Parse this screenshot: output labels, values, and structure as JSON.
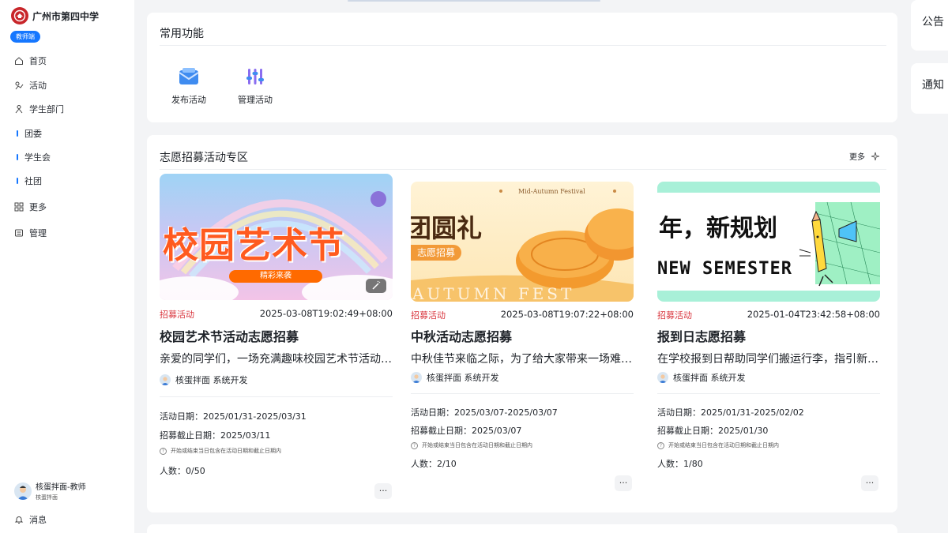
{
  "school": {
    "name": "广州市第四中学",
    "role": "教师端"
  },
  "nav": {
    "home": "首页",
    "activity": "活动",
    "department": "学生部门",
    "sub": [
      "团委",
      "学生会",
      "社团"
    ],
    "more": "更多",
    "manage": "管理"
  },
  "user": {
    "name": "核蛋拌面-教师",
    "sub": "核蛋拌面"
  },
  "messages": "消息",
  "common": {
    "title": "常用功能",
    "functions": [
      {
        "label": "发布活动",
        "icon": "envelope-icon"
      },
      {
        "label": "管理活动",
        "icon": "sliders-icon"
      }
    ]
  },
  "volunteer": {
    "title": "志愿招募活动专区",
    "more": "更多",
    "cards": [
      {
        "category": "招募活动",
        "time": "2025-03-08T19:02:49+08:00",
        "title": "校园艺术节活动志愿招募",
        "desc": "亲爱的同学们，一场充满趣味校园艺术节活动即将开始，诚邀你加入志愿者团队",
        "author": "核蛋拌面 系统开发",
        "date_label": "活动日期：2025/01/31-2025/03/31",
        "deadline_label": "招募截止日期：2025/03/11",
        "note": "开始或结束当日包含在活动日期和截止日期内",
        "people": "人数：0/50",
        "banner_text": "校园艺术节",
        "banner_pill": "精彩来袭"
      },
      {
        "category": "招募活动",
        "time": "2025-03-08T19:07:22+08:00",
        "title": "中秋活动志愿招募",
        "desc": "中秋佳节来临之际，为了给大家带来一场难忘的中秋活动",
        "author": "核蛋拌面 系统开发",
        "date_label": "活动日期：2025/03/07-2025/03/07",
        "deadline_label": "招募截止日期：2025/03/07",
        "note": "开始或结束当日包含在活动日期和截止日期内",
        "people": "人数：2/10",
        "banner_text": "团圆礼",
        "banner_tag": "志愿招募",
        "banner_small": "Mid-Autumn Festival",
        "banner_big": "AUTUMN FEST"
      },
      {
        "category": "招募活动",
        "time": "2025-01-04T23:42:58+08:00",
        "title": "报到日志愿招募",
        "desc": "在学校报到日帮助同学们搬运行李，指引新生熟悉校园环境",
        "author": "核蛋拌面 系统开发",
        "date_label": "活动日期：2025/01/31-2025/02/02",
        "deadline_label": "招募截止日期：2025/01/30",
        "note": "开始或结束当日包含在活动日期和截止日期内",
        "people": "人数：1/80",
        "banner_text": "年，新规划",
        "banner_sub": "NEW SEMESTER"
      }
    ]
  },
  "right": {
    "announcement": "公告",
    "notice": "通知"
  },
  "colors": {
    "accent": "#1677ff",
    "category": "#d9363e",
    "brand": "#c8262a"
  }
}
